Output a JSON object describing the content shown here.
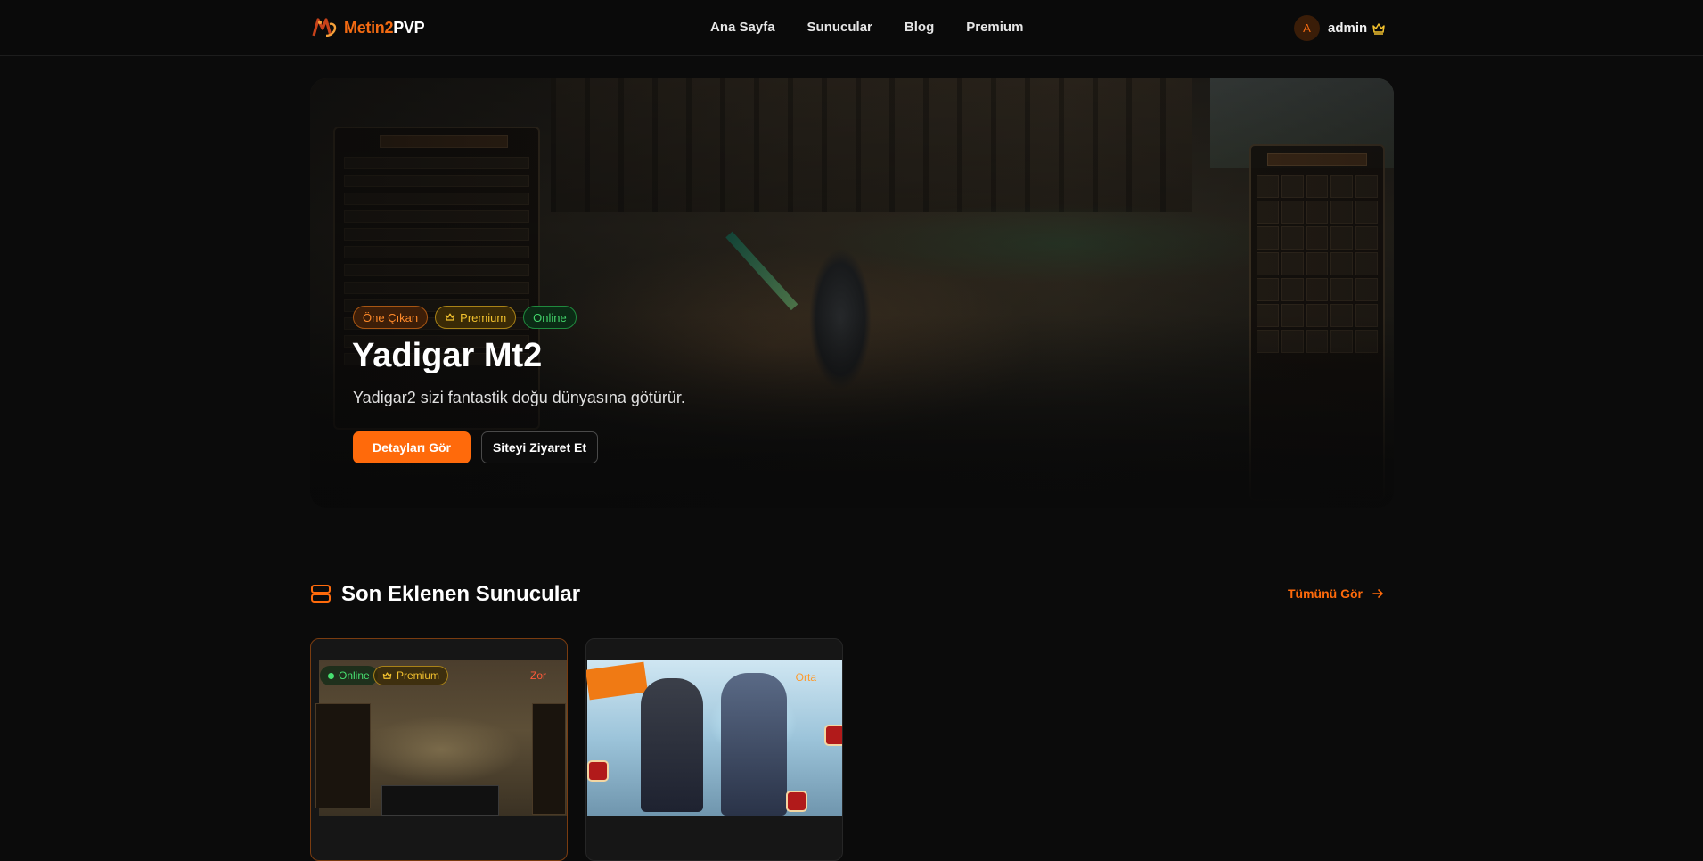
{
  "brand": {
    "name_part1": "Metin2",
    "name_part2": "PVP",
    "accent": "#ff6a0b"
  },
  "nav": {
    "items": [
      "Ana Sayfa",
      "Sunucular",
      "Blog",
      "Premium"
    ]
  },
  "user": {
    "avatar_letter": "A",
    "name": "admin",
    "icon": "crown-icon"
  },
  "hero": {
    "badges": {
      "featured": "Öne Çıkan",
      "premium": "Premium",
      "online": "Online"
    },
    "title": "Yadigar Mt2",
    "description": "Yadigar2 sizi fantastik doğu dünyasına götürür.",
    "primary_button": "Detayları Gör",
    "secondary_button": "Siteyi Ziyaret Et"
  },
  "section": {
    "title": "Son Eklenen Sunucular",
    "see_all": "Tümünü Gör",
    "icon": "server-icon"
  },
  "cards": [
    {
      "badge_online": "Online",
      "badge_premium": "Premium",
      "badge_corner": "Zor"
    },
    {
      "badge_corner": "Orta"
    }
  ]
}
